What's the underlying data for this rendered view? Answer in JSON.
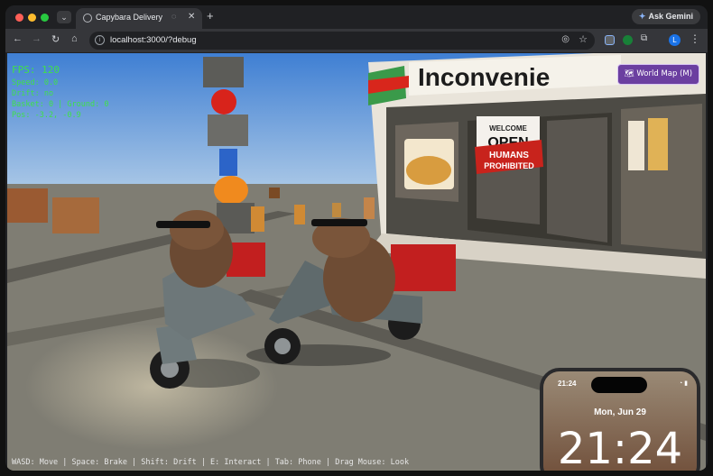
{
  "browser": {
    "tab_title": "Capybara Delivery",
    "new_tab_symbol": "+",
    "gemini_label": "Ask Gemini",
    "url": "localhost:3000/?debug",
    "profile_initial": "L"
  },
  "hud": {
    "fps": "FPS: 120",
    "speed": "Speed: 0.0",
    "drift": "Drift: no",
    "basket": "Basket: 0 | Ground: 0",
    "pos": "Pos: -3.2, -0.9"
  },
  "world_map_button": "🗺 World Map (M)",
  "store": {
    "sign": "Inconvenie",
    "door_sign_welcome": "WELCOME",
    "door_sign_open": "OPEN",
    "prohibited_line1": "HUMANS",
    "prohibited_line2": "PROHIBITED"
  },
  "controls_hint": "WASD: Move | Space: Brake | Shift: Drift | E: Interact | Tab: Phone | Drag Mouse: Look",
  "phone": {
    "status_time": "21:24",
    "date": "Mon, Jun 29",
    "clock": "21:24"
  },
  "colors": {
    "hud_green": "#3fe04a",
    "world_map_purple": "#6b3fa0",
    "sky_top": "#3f7fd3",
    "ground": "#7f7d73"
  }
}
